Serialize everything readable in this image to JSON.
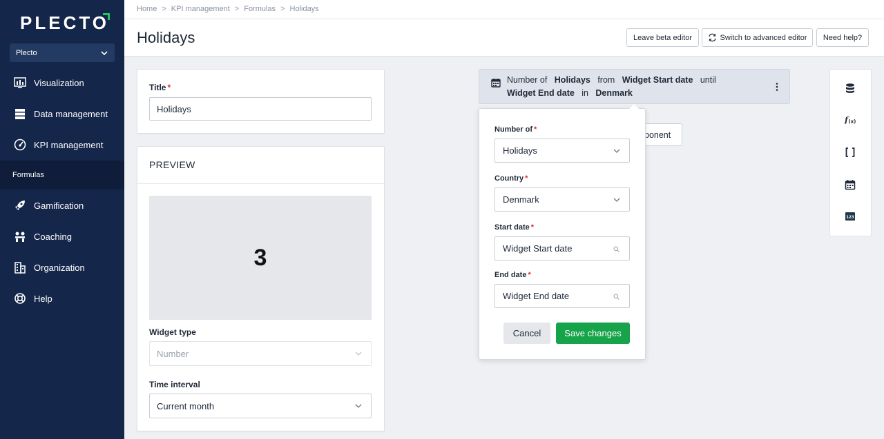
{
  "sidebar": {
    "logo": "PLECTO",
    "org_select": "Plecto",
    "items": [
      {
        "label": "Visualization",
        "icon": "chart-icon"
      },
      {
        "label": "Data management",
        "icon": "database-icon"
      },
      {
        "label": "KPI management",
        "icon": "gauge-icon"
      },
      {
        "label": "Gamification",
        "icon": "rocket-icon"
      },
      {
        "label": "Coaching",
        "icon": "coaching-icon"
      },
      {
        "label": "Organization",
        "icon": "building-icon"
      },
      {
        "label": "Help",
        "icon": "lifebuoy-icon"
      }
    ],
    "sub_item": "Formulas"
  },
  "breadcrumb": [
    "Home",
    ">",
    "KPI management",
    ">",
    "Formulas",
    ">",
    "Holidays"
  ],
  "header": {
    "title": "Holidays",
    "leave_beta": "Leave beta editor",
    "switch_advanced": "Switch to advanced editor",
    "need_help": "Need help?"
  },
  "title_card": {
    "label": "Title",
    "value": "Holidays"
  },
  "preview": {
    "heading": "PREVIEW",
    "value": "3",
    "widget_type_label": "Widget type",
    "widget_type_value": "Number",
    "time_interval_label": "Time interval",
    "time_interval_value": "Current month"
  },
  "formula": {
    "w1": "Number of",
    "v1": "Holidays",
    "w2": "from",
    "v2": "Widget Start date",
    "w3": "until",
    "v3": "Widget End date",
    "w4": "in",
    "v4": "Denmark"
  },
  "behind_button": "ponent",
  "popover": {
    "number_of_label": "Number of",
    "number_of_value": "Holidays",
    "country_label": "Country",
    "country_value": "Denmark",
    "start_label": "Start date",
    "start_value": "Widget Start date",
    "end_label": "End date",
    "end_value": "Widget End date",
    "cancel": "Cancel",
    "save": "Save changes"
  },
  "rail_icons": [
    "database-icon",
    "function-icon",
    "brackets-icon",
    "calendar-icon",
    "number-icon"
  ],
  "colors": {
    "sidebar_bg": "#14264a",
    "accent_green": "#16a34a",
    "required_red": "#d32f2f"
  }
}
